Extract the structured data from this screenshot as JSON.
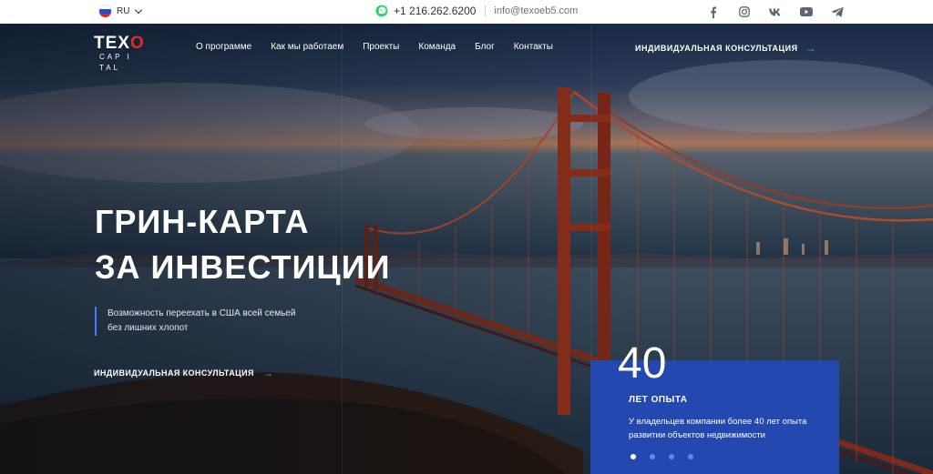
{
  "topbar": {
    "lang": "RU",
    "flag_colors": [
      "#ffffff",
      "#1e4fd6",
      "#d52b1e"
    ],
    "phone": "+1 216.262.6200",
    "email": "info@texoeb5.com",
    "socials": [
      "facebook-icon",
      "instagram-icon",
      "vk-icon",
      "youtube-icon",
      "telegram-icon"
    ]
  },
  "logo": {
    "mark_left": "TEX",
    "mark_accent": "O",
    "sub": "CAP I TAL"
  },
  "nav": {
    "items": [
      "О программе",
      "Как мы работаем",
      "Проекты",
      "Команда",
      "Блог",
      "Контакты"
    ],
    "cta": "ИНДИВИДУАЛЬНАЯ КОНСУЛЬТАЦИЯ"
  },
  "hero": {
    "title_line1": "ГРИН-КАРТА",
    "title_line2": "ЗА ИНВЕСТИЦИИ",
    "subtitle": "Возможность переехать в США всей семьей без лишних хлопот",
    "cta": "ИНДИВИДУАЛЬНАЯ КОНСУЛЬТАЦИЯ"
  },
  "card": {
    "number": "40",
    "label": "ЛЕТ ОПЫТА",
    "desc": "У владельцев компании более 40 лет опыта развитии объектов недвижимости",
    "slides": 4,
    "active_slide": 1
  },
  "colors": {
    "accent": "#2348b0",
    "link_arrow": "#5b8cff",
    "logo_red": "#e22b26",
    "whatsapp": "#25d366"
  }
}
